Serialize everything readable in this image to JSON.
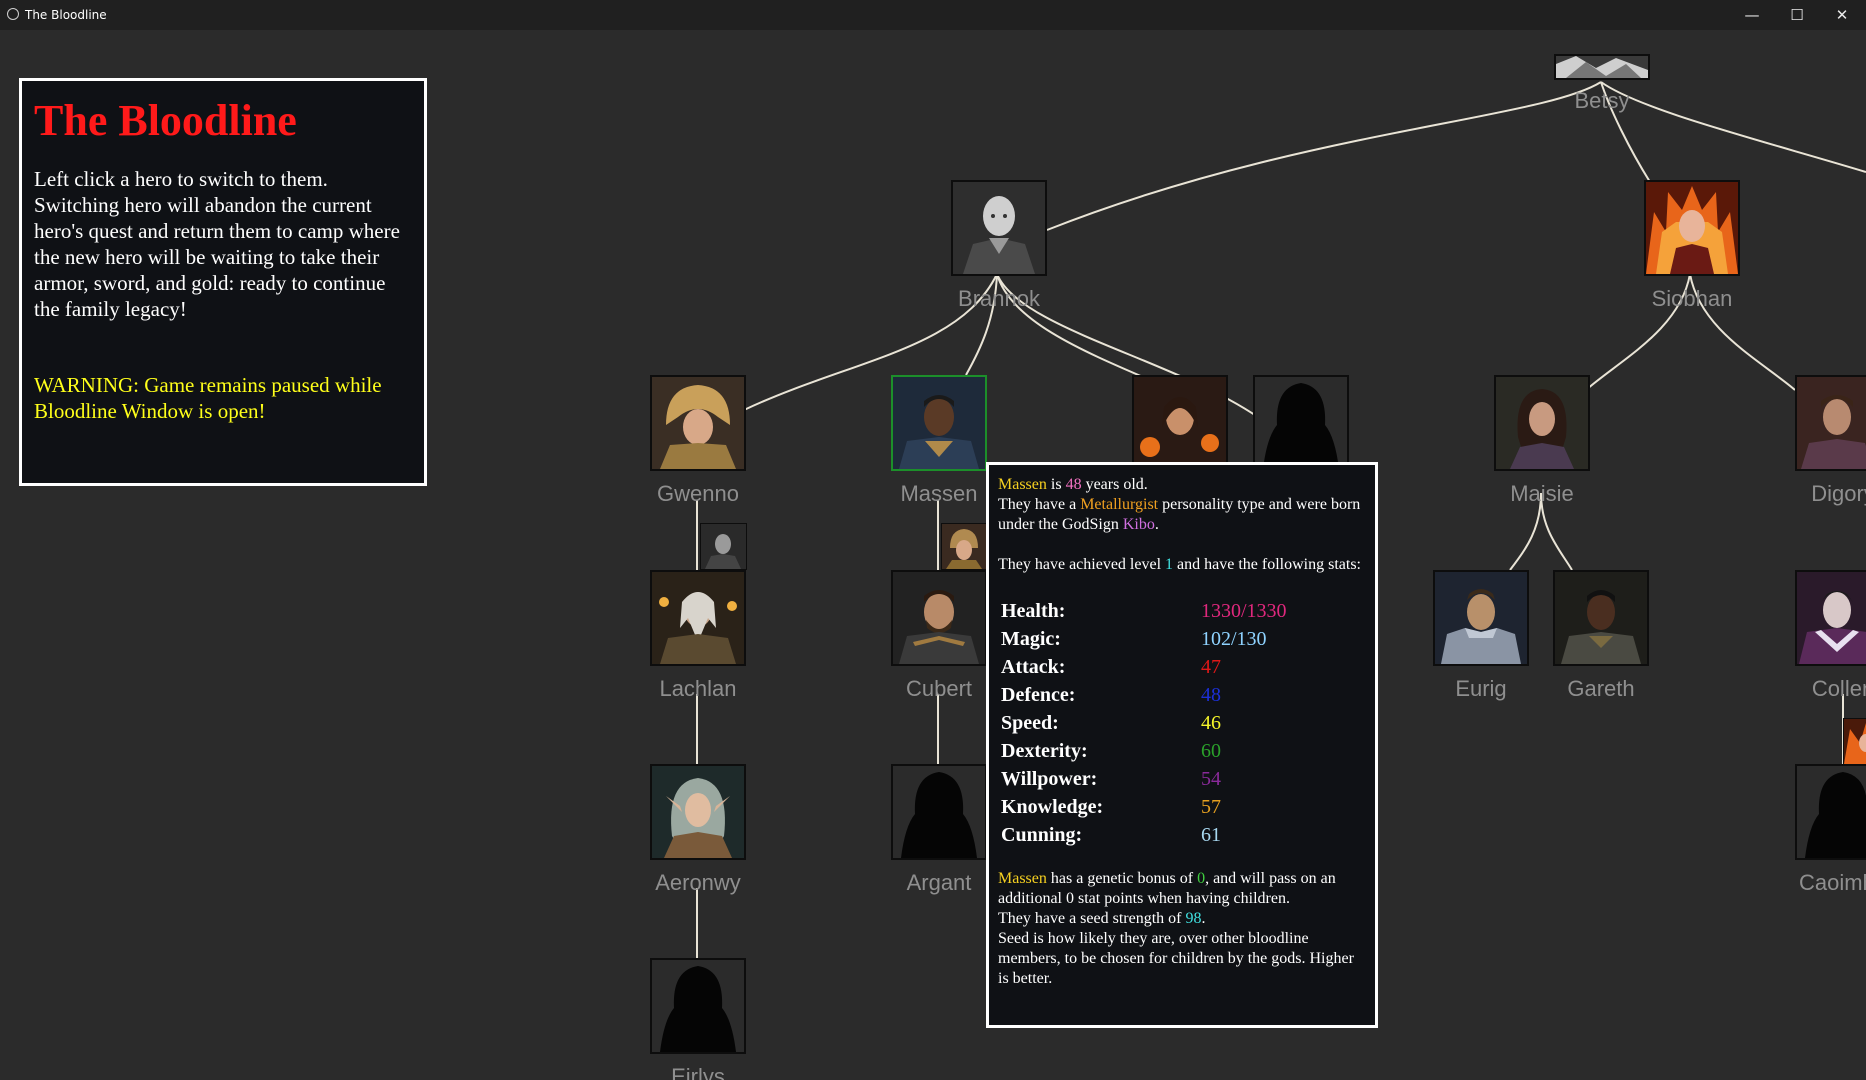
{
  "window": {
    "title": "The Bloodline",
    "minimize_glyph": "—",
    "maximize_glyph": "☐",
    "close_glyph": "✕"
  },
  "info_panel": {
    "title": "The Bloodline",
    "instructions": "Left click a hero to switch to them. Switching hero will abandon the current hero's quest and return them to camp where the new hero will be waiting to take their armor, sword, and gold: ready to continue the family legacy!",
    "warning": "WARNING: Game remains paused while Bloodline Window is open!"
  },
  "tree": {
    "selected": "Massen",
    "nodes": [
      {
        "id": "betsy",
        "name": "Betsy",
        "portrait": "cropped-bw"
      },
      {
        "id": "brannok",
        "name": "Brannok",
        "portrait": "bald-monk"
      },
      {
        "id": "siobhan",
        "name": "Siobhan",
        "portrait": "fire-mage"
      },
      {
        "id": "gwenno",
        "name": "Gwenno",
        "portrait": "helmed-warrior"
      },
      {
        "id": "massen",
        "name": "Massen",
        "portrait": "dark-knight"
      },
      {
        "id": "fire-sibling",
        "name": "",
        "portrait": "fire-woman"
      },
      {
        "id": "hooded-sibling",
        "name": "",
        "portrait": "silhouette"
      },
      {
        "id": "maisie",
        "name": "Maisie",
        "portrait": "dark-haired-woman"
      },
      {
        "id": "digory",
        "name": "Digory",
        "portrait": "armored-man"
      },
      {
        "id": "lachlan",
        "name": "Lachlan",
        "portrait": "old-sage"
      },
      {
        "id": "cubert",
        "name": "Cubert",
        "portrait": "bearded-knight"
      },
      {
        "id": "eurig",
        "name": "Eurig",
        "portrait": "armored-knight"
      },
      {
        "id": "gareth",
        "name": "Gareth",
        "portrait": "dark-knight"
      },
      {
        "id": "collen",
        "name": "Collen",
        "portrait": "vampire-noble"
      },
      {
        "id": "aeronwy",
        "name": "Aeronwy",
        "portrait": "elf-woman"
      },
      {
        "id": "argant",
        "name": "Argant",
        "portrait": "silhouette"
      },
      {
        "id": "caoimhe",
        "name": "Caoimhe",
        "portrait": "silhouette"
      },
      {
        "id": "eirlys",
        "name": "Eirlys",
        "portrait": "silhouette"
      }
    ]
  },
  "tooltip": {
    "hero_name": "Massen",
    "age": "48",
    "intro_is": " is ",
    "intro_years_old": " years old.",
    "personality_prefix": "They have a ",
    "personality": "Metallurgist",
    "personality_suffix": " personality type and were born under the GodSign ",
    "godsign": "Kibo",
    "period": ".",
    "level_prefix": "They have achieved level ",
    "level": "1",
    "level_suffix": " and have the following stats:",
    "stats": [
      {
        "label": "Health:",
        "value": "1330/1330",
        "color": "#e0287d"
      },
      {
        "label": "Magic:",
        "value": "102/130",
        "color": "#8fd3ff"
      },
      {
        "label": "Attack:",
        "value": "47",
        "color": "#e01818"
      },
      {
        "label": "Defence:",
        "value": "48",
        "color": "#1c2fd6"
      },
      {
        "label": "Speed:",
        "value": "46",
        "color": "#f5f52a"
      },
      {
        "label": "Dexterity:",
        "value": "60",
        "color": "#2aa02a"
      },
      {
        "label": "Willpower:",
        "value": "54",
        "color": "#8a2a9a"
      },
      {
        "label": "Knowledge:",
        "value": "57",
        "color": "#e6a020"
      },
      {
        "label": "Cunning:",
        "value": "61",
        "color": "#a8d8f0"
      }
    ],
    "bonus_mid": " has a genetic bonus of ",
    "genetic_bonus": "0",
    "bonus_tail": ", and will pass on an additional 0 stat points when having children.",
    "seed_prefix": "They have a seed strength of ",
    "seed_strength": "98",
    "seed_explain": "Seed is how likely they are, over other bloodline members, to be chosen for children by the gods. Higher is better.",
    "colors": {
      "name": "#f5d020",
      "age": "#f070c0",
      "personality": "#f0a020",
      "godsign": "#d070e0",
      "level": "#40e0e0",
      "bonus": "#40d040",
      "seed": "#40e0e0"
    }
  }
}
